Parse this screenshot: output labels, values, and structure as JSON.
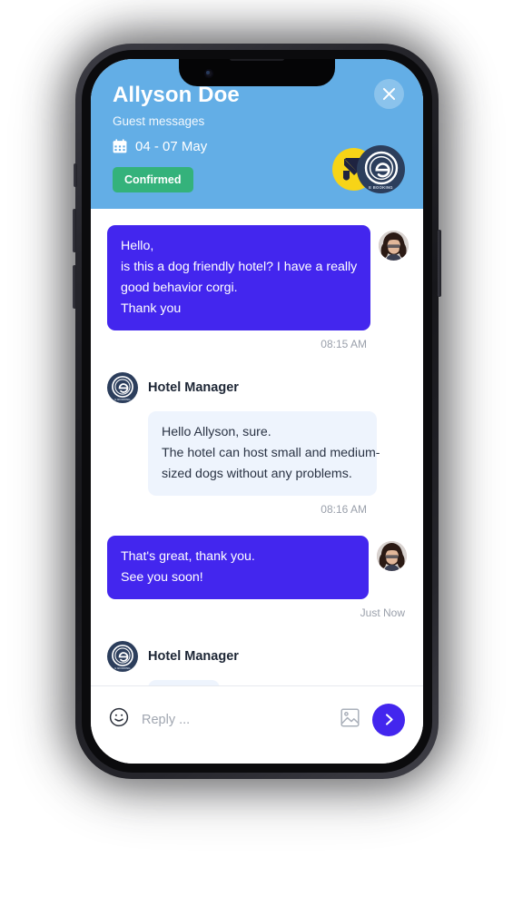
{
  "header": {
    "title": "Allyson Doe",
    "subtitle": "Guest messages",
    "calendar_icon": "calendar-icon",
    "dates": "04 - 07 May",
    "status_badge": "Confirmed",
    "close_icon": "close-icon",
    "background_color": "#63AEE6",
    "badge_color": "#34b27b",
    "logos": [
      {
        "name": "yellow-arrow-logo",
        "color": "#F7D417"
      },
      {
        "name": "e-booking-logo",
        "color": "#2C3E5C",
        "caption": "E BOOKING"
      }
    ]
  },
  "conversation": {
    "messages": [
      {
        "sender": "guest",
        "avatar": "guest-avatar",
        "lines": [
          "Hello,",
          "is this a dog friendly hotel? I have a really",
          "good behavior corgi.",
          "Thank you"
        ],
        "timestamp": "08:15 AM",
        "bubble_color": "#4326EE"
      },
      {
        "sender": "manager",
        "name": "Hotel Manager",
        "avatar": "hotel-manager-logo",
        "lines": [
          "Hello Allyson, sure.",
          "The hotel can host small and medium-",
          "sized dogs without any problems."
        ],
        "timestamp": "08:16 AM",
        "bubble_color": "#EEF4FD"
      },
      {
        "sender": "guest",
        "avatar": "guest-avatar",
        "lines": [
          "That's great, thank you.",
          "See you soon!"
        ],
        "timestamp": "Just Now",
        "bubble_color": "#4326EE"
      },
      {
        "sender": "manager",
        "name": "Hotel Manager",
        "avatar": "hotel-manager-logo",
        "typing": true,
        "bubble_color": "#EEF4FD",
        "dot_color": "#BDD6F5"
      }
    ]
  },
  "composer": {
    "emoji_icon": "emoji-icon",
    "placeholder": "Reply ...",
    "value": "",
    "image_icon": "image-attachment-icon",
    "send_icon": "send-chevron-icon",
    "send_color": "#4326EE"
  }
}
